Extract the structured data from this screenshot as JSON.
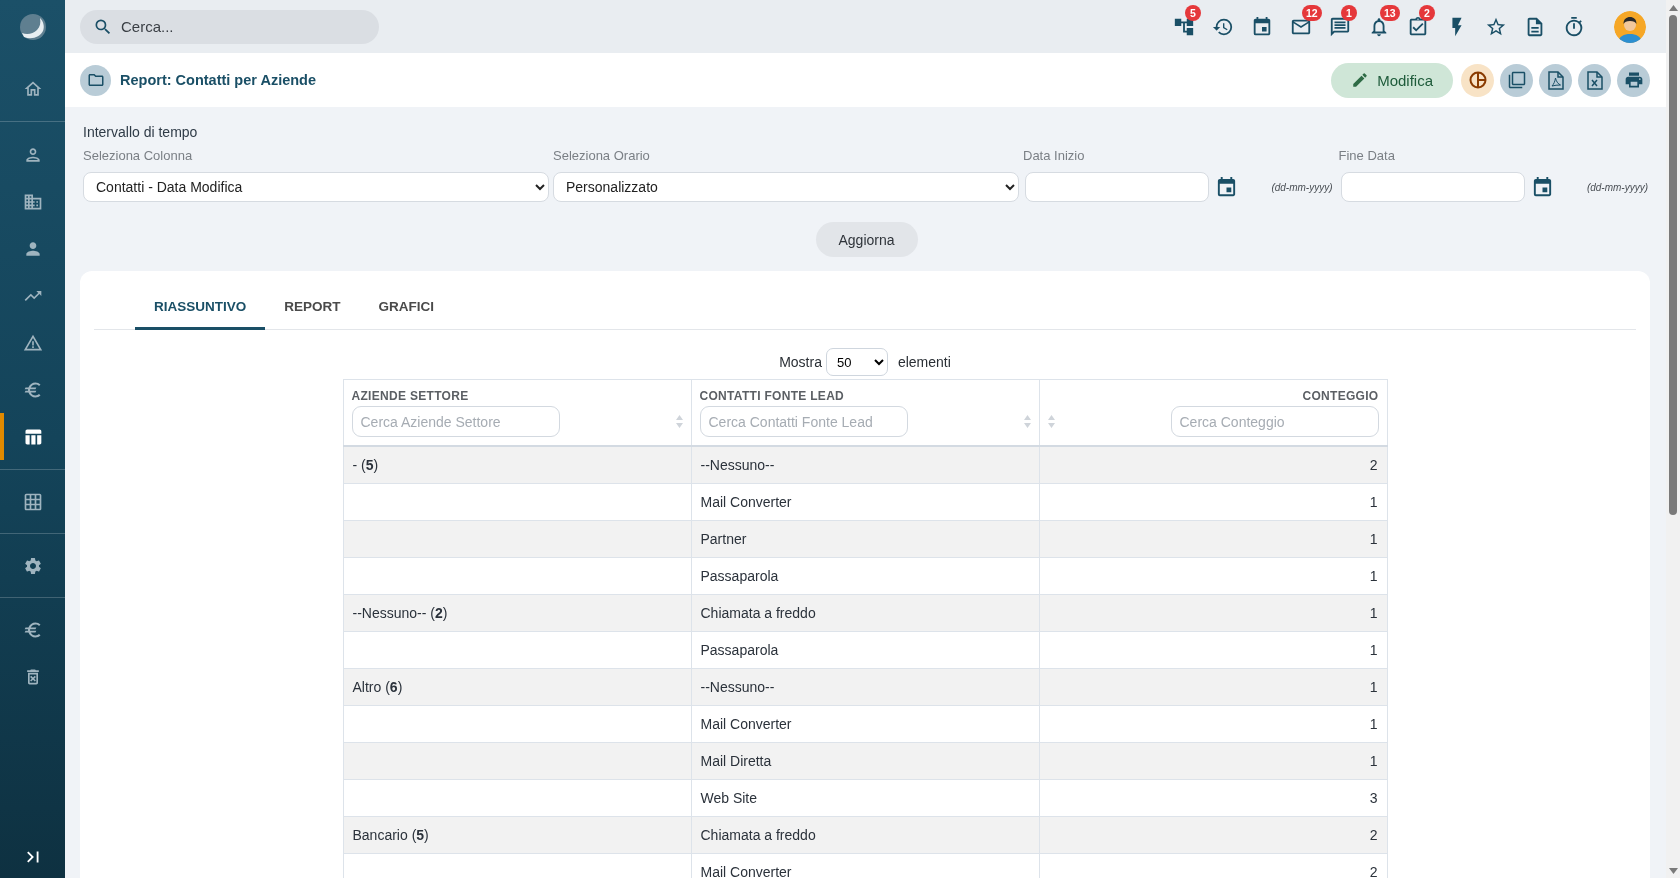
{
  "sidebar": {
    "groups": [
      {
        "items": [
          {
            "selected": false
          }
        ]
      },
      {
        "items": [
          {
            "selected": false
          },
          {
            "selected": false
          },
          {
            "selected": false
          },
          {
            "selected": false
          },
          {
            "selected": false
          },
          {
            "selected": false
          },
          {
            "selected": true
          }
        ]
      },
      {
        "items": [
          {
            "selected": false
          }
        ]
      },
      {
        "items": [
          {
            "selected": false
          }
        ]
      },
      {
        "items": [
          {
            "selected": false
          },
          {
            "selected": false
          }
        ]
      }
    ]
  },
  "search": {
    "placeholder": "Cerca..."
  },
  "toolbar": {
    "icons": [
      {
        "has_badge": true,
        "badge": "5"
      },
      {
        "has_badge": false
      },
      {
        "has_badge": false
      },
      {
        "has_badge": true,
        "badge": "12"
      },
      {
        "has_badge": true,
        "badge": "1"
      },
      {
        "has_badge": true,
        "badge": "13"
      },
      {
        "has_badge": true,
        "badge": "2"
      },
      {
        "has_badge": false
      },
      {
        "has_badge": false
      },
      {
        "has_badge": false
      },
      {
        "has_badge": false
      }
    ]
  },
  "header": {
    "title": "Report: Contatti per Aziende",
    "edit_button": "Modifica"
  },
  "filters": {
    "title": "Intervallo di tempo",
    "column_select": {
      "label": "Seleziona Colonna",
      "value": "Contatti - Data Modifica"
    },
    "time_select": {
      "label": "Seleziona Orario",
      "value": "Personalizzato"
    },
    "start_date": {
      "label": "Data Inizio",
      "format_hint": "(dd-mm-yyyy)"
    },
    "end_date": {
      "label": "Fine Data",
      "format_hint": "(dd-mm-yyyy)"
    },
    "update_button": "Aggiorna"
  },
  "tabs": [
    {
      "label": "RIASSUNTIVO",
      "selected": true
    },
    {
      "label": "REPORT",
      "selected": false
    },
    {
      "label": "GRAFICI",
      "selected": false
    }
  ],
  "page_length": {
    "label": "Mostra",
    "value": "50",
    "suffix": "elementi"
  },
  "table": {
    "columns": [
      {
        "label": "AZIENDE SETTORE",
        "placeholder": "Cerca Aziende Settore",
        "kind": "text"
      },
      {
        "label": "CONTATTI FONTE LEAD",
        "placeholder": "Cerca Contatti Fonte Lead",
        "kind": "text"
      },
      {
        "label": "CONTEGGIO",
        "placeholder": "Cerca Conteggio",
        "kind": "number"
      }
    ],
    "rows": [
      {
        "sector": "- (**5**)",
        "source": "--Nessuno--",
        "count": "2"
      },
      {
        "source": "Mail Converter",
        "count": "1"
      },
      {
        "source": "Partner",
        "count": "1"
      },
      {
        "source": "Passaparola",
        "count": "1"
      },
      {
        "sector": "--Nessuno-- (**2**)",
        "source": "Chiamata a freddo",
        "count": "1"
      },
      {
        "source": "Passaparola",
        "count": "1"
      },
      {
        "sector": "Altro (**6**)",
        "source": "--Nessuno--",
        "count": "1"
      },
      {
        "source": "Mail Converter",
        "count": "1"
      },
      {
        "source": "Mail Diretta",
        "count": "1"
      },
      {
        "source": "Web Site",
        "count": "3"
      },
      {
        "sector": "Bancario (**5**)",
        "source": "Chiamata a freddo",
        "count": "2"
      },
      {
        "source": "Mail Converter",
        "count": "2"
      }
    ]
  }
}
